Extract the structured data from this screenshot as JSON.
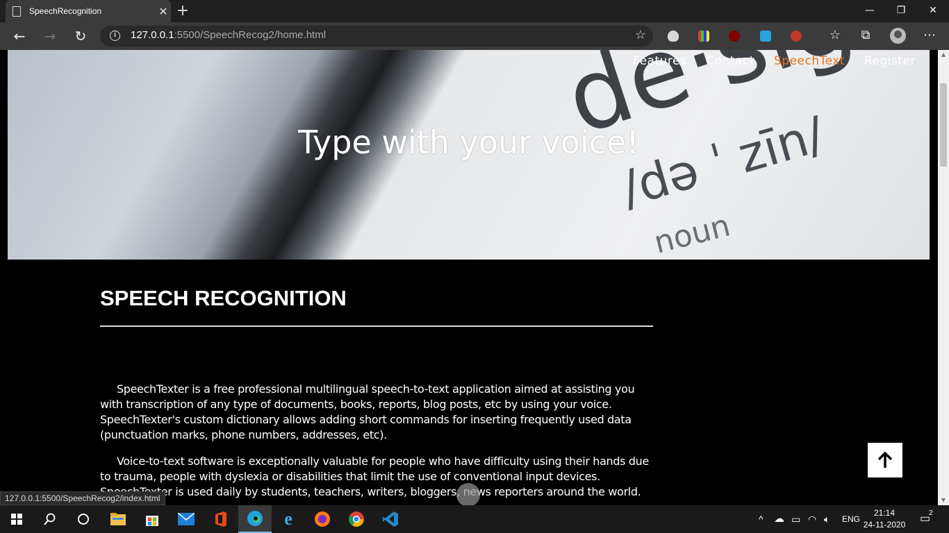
{
  "browser": {
    "tab_title": "SpeechRecognition",
    "url_host": "127.0.0.1",
    "url_path": ":5500/SpeechRecog2/home.html"
  },
  "nav": {
    "items": [
      {
        "label": "Features",
        "active": false
      },
      {
        "label": "Contact",
        "active": false
      },
      {
        "label": "SpeechText",
        "active": true
      },
      {
        "label": "Register",
        "active": false
      }
    ]
  },
  "hero": {
    "headline": "Type with your voice!",
    "image_words": [
      "de·sig",
      "/də ˈ zīn/",
      "noun"
    ]
  },
  "content": {
    "section_title": "SPEECH RECOGNITION",
    "paragraph1": "SpeechTexter is a free professional multilingual speech-to-text application aimed at assisting you with transcription of any type of documents, books, reports, blog posts, etc by using your voice. SpeechTexter's custom dictionary allows adding short commands for inserting frequently used data (punctuation marks, phone numbers, addresses, etc).",
    "paragraph2": "Voice-to-text software is exceptionally valuable for people who have difficulty using their hands due to trauma, people with dyslexia or disabilities that limit the use of conventional input devices. SpeechTexter is used daily by students, teachers, writers, bloggers, news reporters around the world."
  },
  "status_bar_url": "127.0.0.1:5500/SpeechRecog2/index.html",
  "taskbar": {
    "language": "ENG",
    "time": "21:14",
    "date": "24-11-2020",
    "notification_count": "2"
  },
  "colors": {
    "accent_active_nav": "#e8731c",
    "page_background": "#000000"
  }
}
